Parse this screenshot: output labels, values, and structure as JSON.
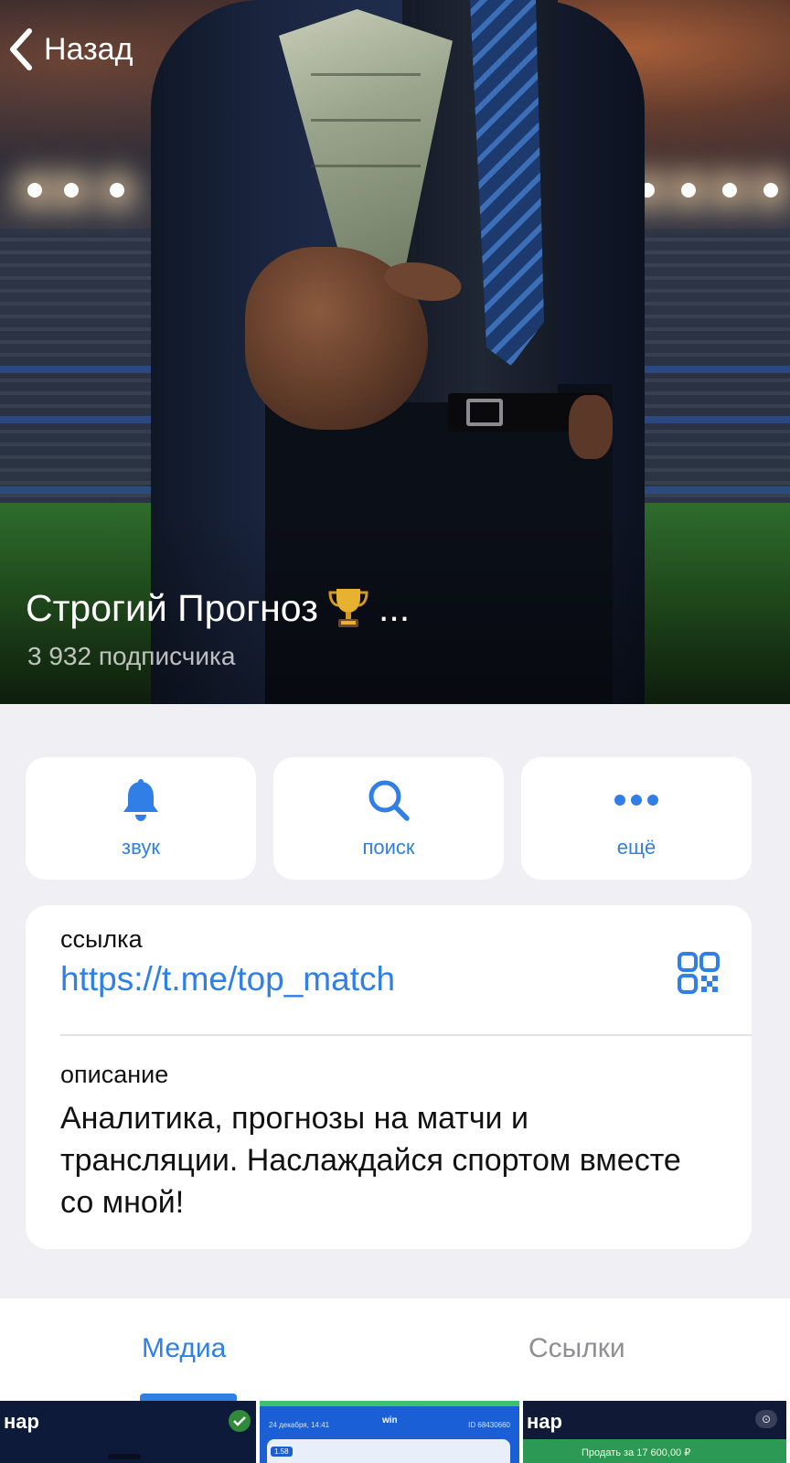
{
  "header": {
    "back_label": "Назад",
    "channel_name": "Строгий Прогноз",
    "title_ellipsis": "...",
    "subscribers": "3 932 подписчика"
  },
  "actions": [
    {
      "label": "звук",
      "icon": "bell-icon"
    },
    {
      "label": "поиск",
      "icon": "search-icon"
    },
    {
      "label": "ещё",
      "icon": "more-dots-icon"
    }
  ],
  "info": {
    "link_label": "ссылка",
    "link_value": "https://t.me/top_match",
    "description_label": "описание",
    "description": "Аналитика, прогнозы на матчи и трансляции. Наслаждайся спортом вместе со мной!"
  },
  "tabs": {
    "media": "Медиа",
    "links": "Ссылки",
    "active": "media"
  },
  "thumbnails": [
    {
      "caption": "нар"
    },
    {
      "date": "24 декабря, 14:41",
      "logo": "win",
      "code": "ID 68430660",
      "odds": "1.58"
    },
    {
      "caption": "нар",
      "sell": "Продать за 17 600,00 ₽"
    }
  ],
  "colors": {
    "accent": "#2f7fe6",
    "background": "#efeff4",
    "card": "#ffffff",
    "muted_text": "#8e8e93"
  }
}
